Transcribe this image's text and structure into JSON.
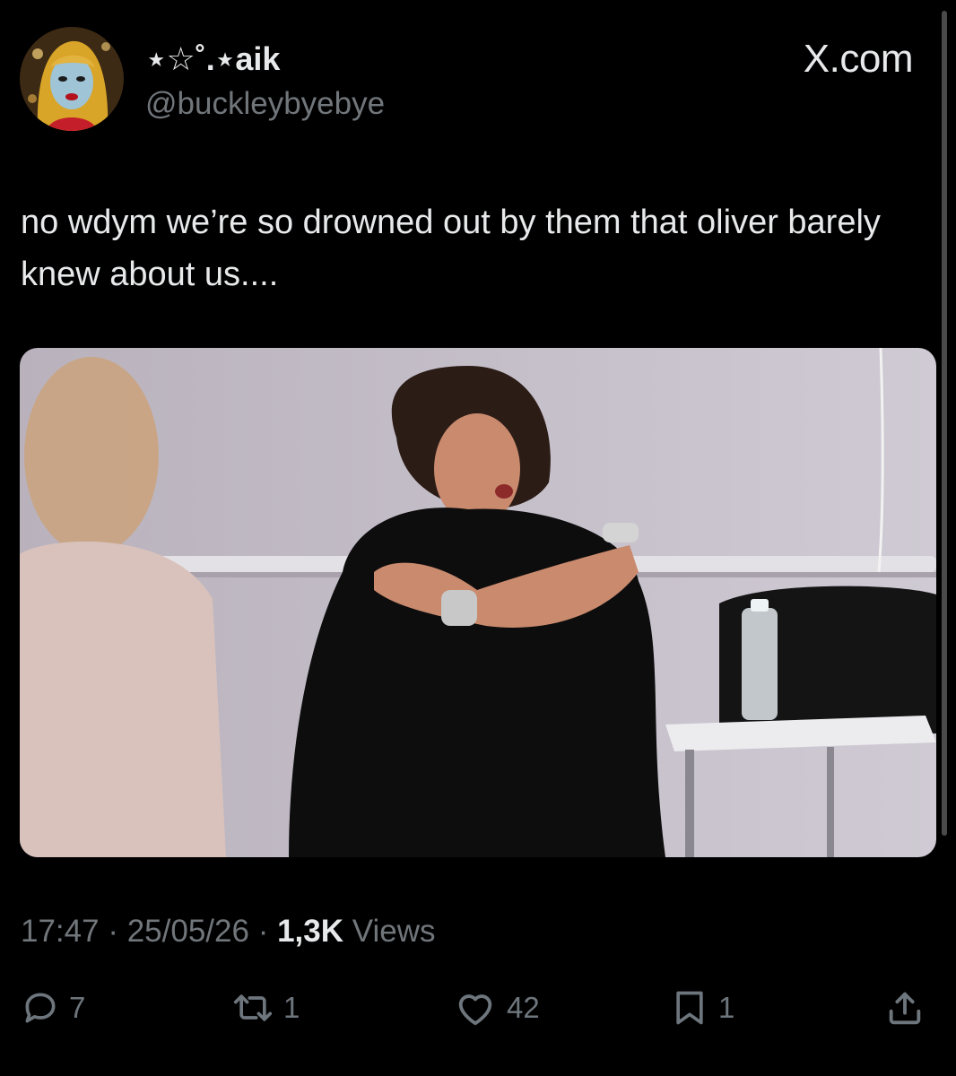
{
  "tweet": {
    "display_name": "⋆☆˚.⋆aik",
    "handle": "@buckleybyebye",
    "text": "no wdym we’re so drowned out by them that oliver barely knew about us....",
    "time": "17:47",
    "date": "25/05/26",
    "separator": "·",
    "views_count": "1,3K",
    "views_label": "Views"
  },
  "brand": {
    "label": "X.com"
  },
  "actions": {
    "reply_count": "7",
    "retweet_count": "1",
    "like_count": "42",
    "bookmark_count": "1"
  },
  "icons": {
    "reply": "reply-icon",
    "retweet": "retweet-icon",
    "like": "heart-icon",
    "bookmark": "bookmark-icon",
    "share": "share-icon"
  },
  "colors": {
    "background": "#000000",
    "primary_text": "#e7e9ea",
    "secondary_text": "#71767b"
  }
}
